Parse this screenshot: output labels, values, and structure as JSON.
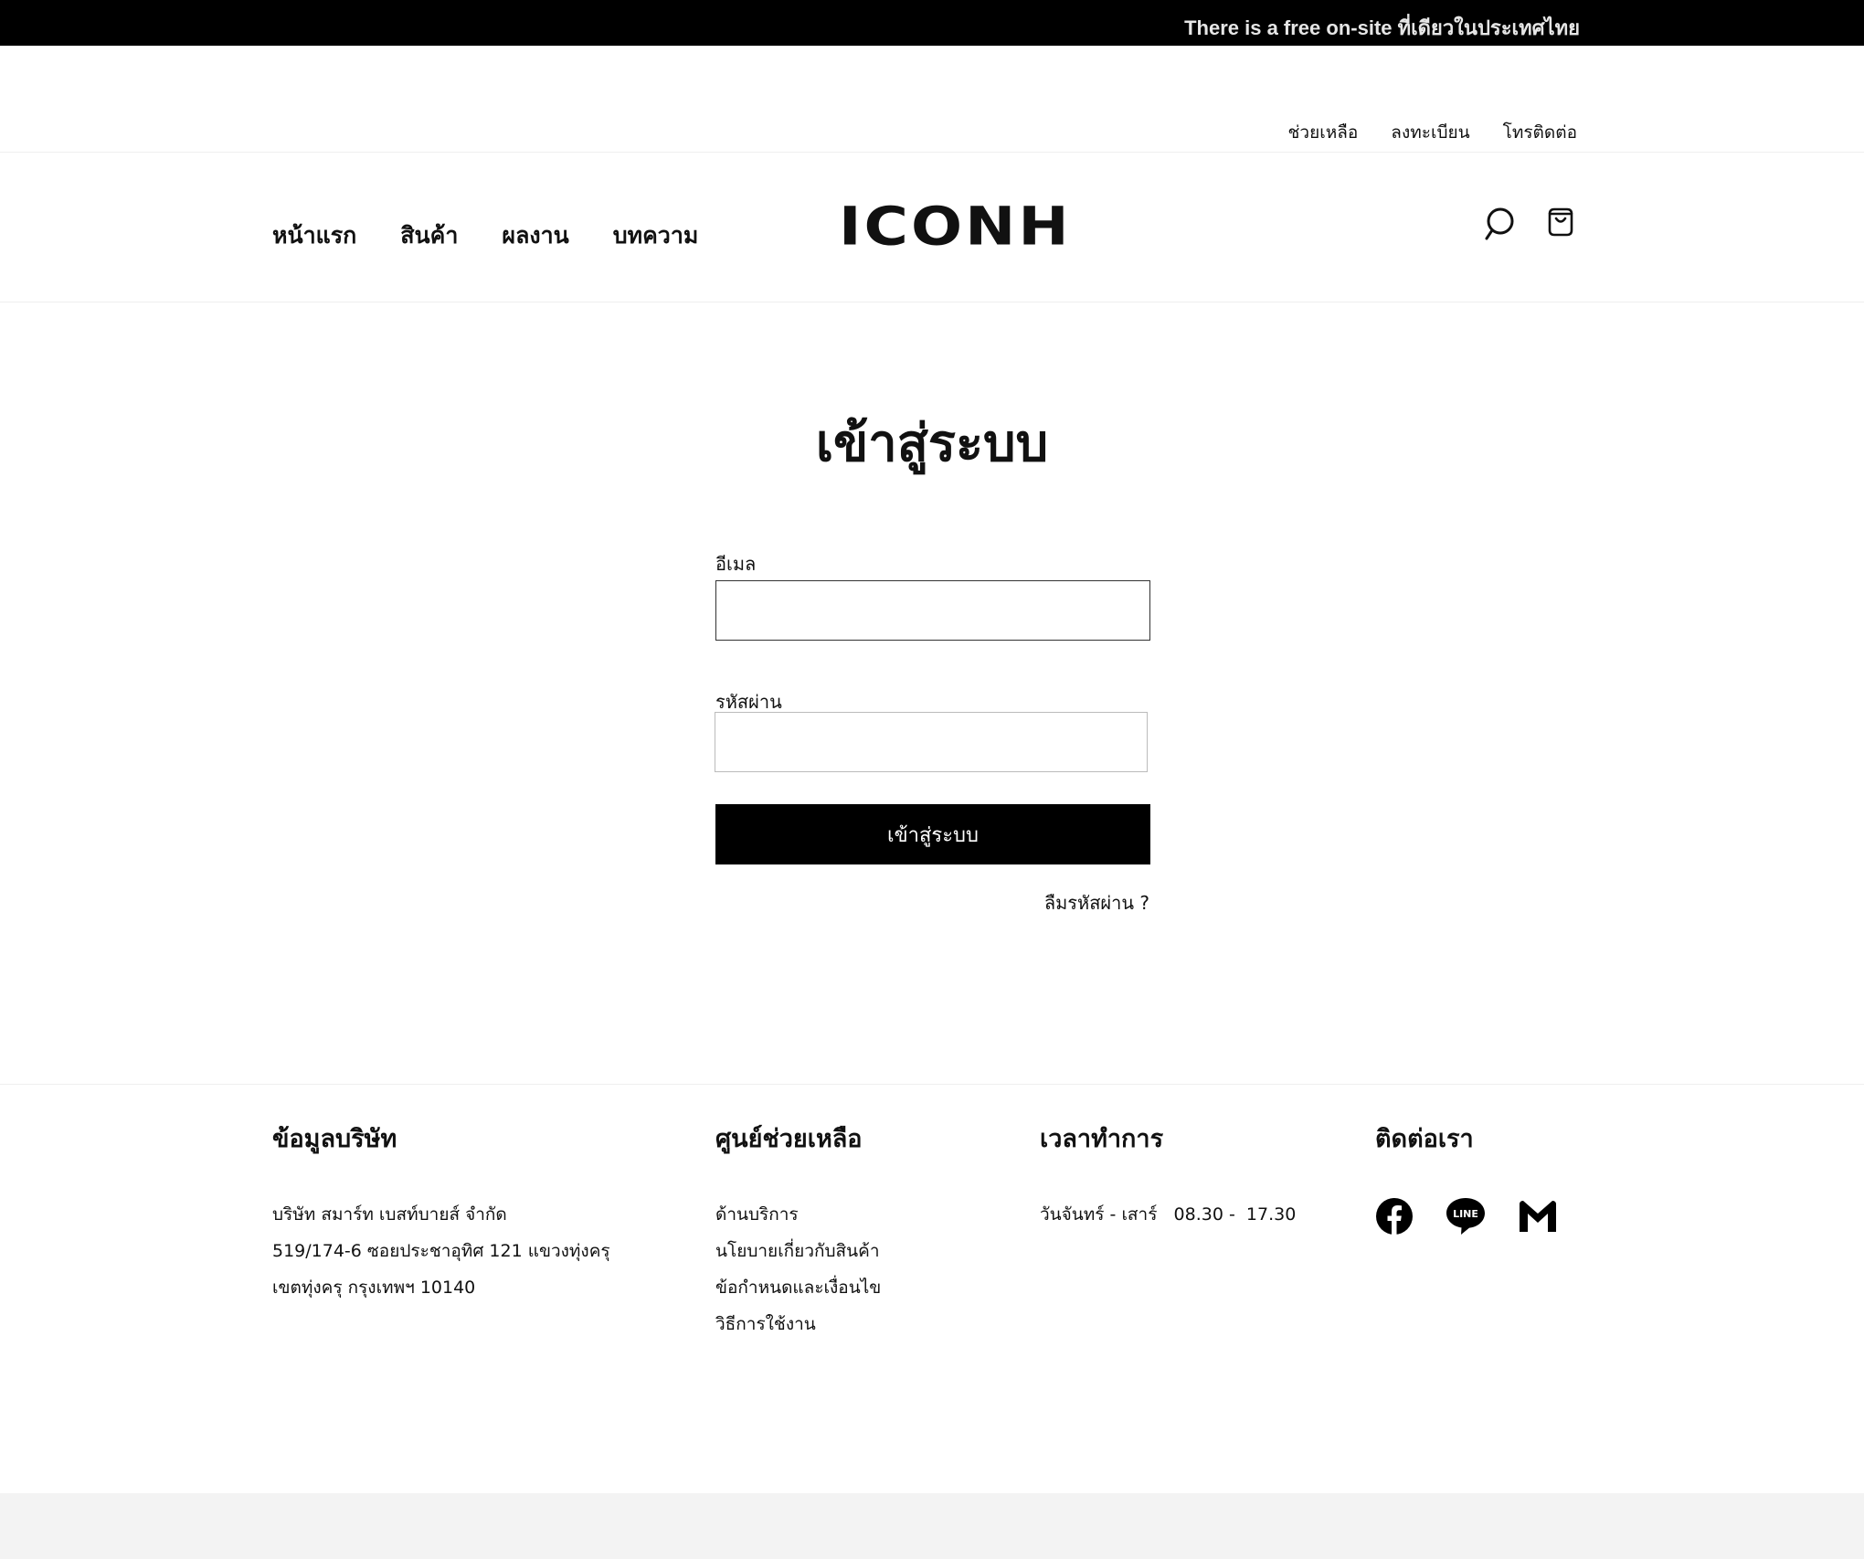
{
  "announcement": "There is a free on-site ที่เดียวในประเทศไทย",
  "utility_links": [
    "ช่วยเหลือ",
    "ลงทะเบียน",
    "โทรติดต่อ"
  ],
  "nav": [
    "หน้าแรก",
    "สินค้า",
    "ผลงาน",
    "บทความ"
  ],
  "brand": "ICONH",
  "icons": {
    "search": "search-icon",
    "cart": "shopping-bag-icon"
  },
  "login": {
    "title": "เข้าสู่ระบบ",
    "email_label": "อีเมล",
    "email_value": "",
    "password_label": "รหัสผ่าน",
    "password_value": "",
    "submit_label": "เข้าสู่ระบบ",
    "forgot_label": "ลืมรหัสผ่าน ?"
  },
  "footer": {
    "company": {
      "heading": "ข้อมูลบริษัท",
      "lines": [
        "บริษัท สมาร์ท เบสท์บายส์ จำกัด",
        "519/174-6 ซอยประชาอุทิศ 121 แขวงทุ่งครุ",
        "เขตทุ่งครุ กรุงเทพฯ 10140"
      ]
    },
    "help": {
      "heading": "ศูนย์ช่วยเหลือ",
      "links": [
        "ด้านบริการ",
        "นโยบายเกี่ยวกับสินค้า",
        "ข้อกำหนดและเงื่อนไข",
        "วิธีการใช้งาน"
      ]
    },
    "hours": {
      "heading": "เวลาทำการ",
      "text": "วันจันทร์ - เสาร์   08.30 -  17.30"
    },
    "contact": {
      "heading": "ติดต่อเรา",
      "socials": [
        "facebook-icon",
        "line-icon",
        "gmail-icon"
      ]
    }
  },
  "colors": {
    "topbar_bg": "#000000",
    "button_bg": "#000000",
    "bottom_band": "#f3f3f3"
  }
}
